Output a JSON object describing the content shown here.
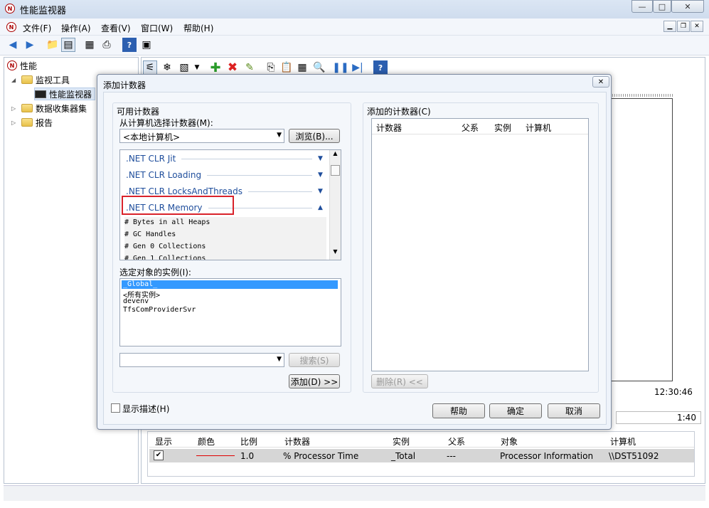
{
  "window": {
    "title": "性能监视器",
    "btn_min": "—",
    "btn_max": "□",
    "btn_close": "✕"
  },
  "menu": {
    "items": [
      "文件(F)",
      "操作(A)",
      "查看(V)",
      "窗口(W)",
      "帮助(H)"
    ]
  },
  "tree": {
    "items": [
      "性能",
      "监视工具",
      "性能监视器",
      "数据收集器集",
      "报告"
    ]
  },
  "graph": {
    "time": "12:30:46",
    "duration": "1:40"
  },
  "grid": {
    "headers": [
      "显示",
      "颜色",
      "比例",
      "计数器",
      "实例",
      "父系",
      "对象",
      "计算机"
    ],
    "row": {
      "show": "✔",
      "scale": "1.0",
      "counter": "% Processor Time",
      "instance": "_Total",
      "parent": "---",
      "object": "Processor Information",
      "computer": "\\\\DST51092"
    }
  },
  "dialog": {
    "title": "添加计数器",
    "available_label": "可用计数器",
    "select_from_label": "从计算机选择计数器(M):",
    "computer_value": "<本地计算机>",
    "browse_button": "浏览(B)...",
    "categories": [
      ".NET CLR Jit",
      ".NET CLR Loading",
      ".NET CLR LocksAndThreads",
      ".NET CLR Memory"
    ],
    "counters": [
      "# Bytes in all Heaps",
      "# GC Handles",
      "# Gen 0 Collections",
      "# Gen 1 Collections"
    ],
    "instances_label": "选定对象的实例(I):",
    "instances": [
      "_Global_",
      "<所有实例>",
      "devenv",
      "TfsComProviderSvr"
    ],
    "search_button": "搜索(S)",
    "add_button": "添加(D) >>",
    "added_label": "添加的计数器(C)",
    "added_headers": [
      "计数器",
      "父系",
      "实例",
      "计算机"
    ],
    "remove_button": "删除(R) <<",
    "show_desc_label": "显示描述(H)",
    "help_button": "帮助",
    "ok_button": "确定",
    "cancel_button": "取消"
  }
}
